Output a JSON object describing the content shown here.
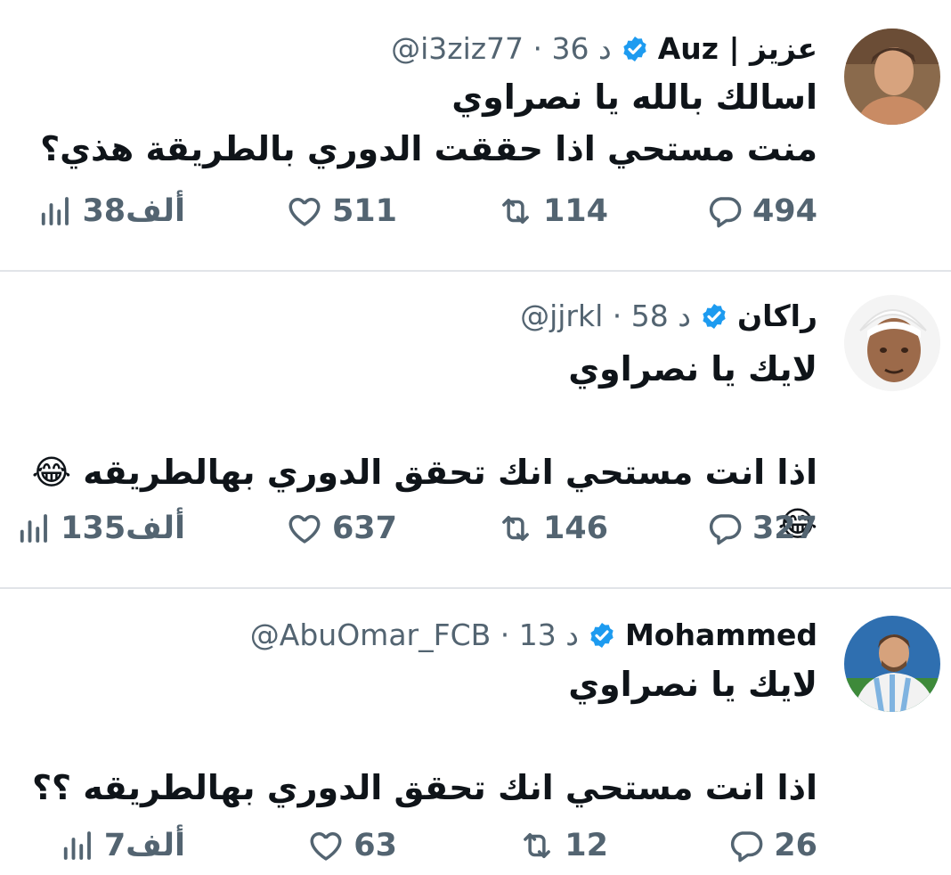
{
  "tweets": [
    {
      "name": "عزيز | Auz",
      "handle": "@i3ziz77",
      "time": "36 د",
      "text": "اسالك بالله يا نصراوي\nمنت مستحي اذا حققت الدوري بالطريقة هذي؟",
      "replies": "494",
      "retweets": "114",
      "likes": "511",
      "views": "38ألف"
    },
    {
      "name": "راكان",
      "handle": "@jjrkl",
      "time": "58 د",
      "text": "لايك يا نصراوي\n\nاذا انت مستحي انك تحقق الدوري بهالطريقه 😂😂",
      "replies": "327",
      "retweets": "146",
      "likes": "637",
      "views": "135ألف"
    },
    {
      "name": "Mohammed",
      "handle": "@AbuOmar_FCB",
      "time": "13 د",
      "text": "لايك يا نصراوي\n\nاذا انت مستحي انك تحقق الدوري بهالطريقه ؟؟",
      "replies": "26",
      "retweets": "12",
      "likes": "63",
      "views": "7ألف"
    }
  ],
  "colors": {
    "verified": "#1d9bf0",
    "muted": "#536471",
    "text": "#0f1419",
    "divider": "#e1e4e8"
  },
  "icons": [
    "verified-badge-icon",
    "reply-icon",
    "retweet-icon",
    "like-icon",
    "views-icon"
  ]
}
